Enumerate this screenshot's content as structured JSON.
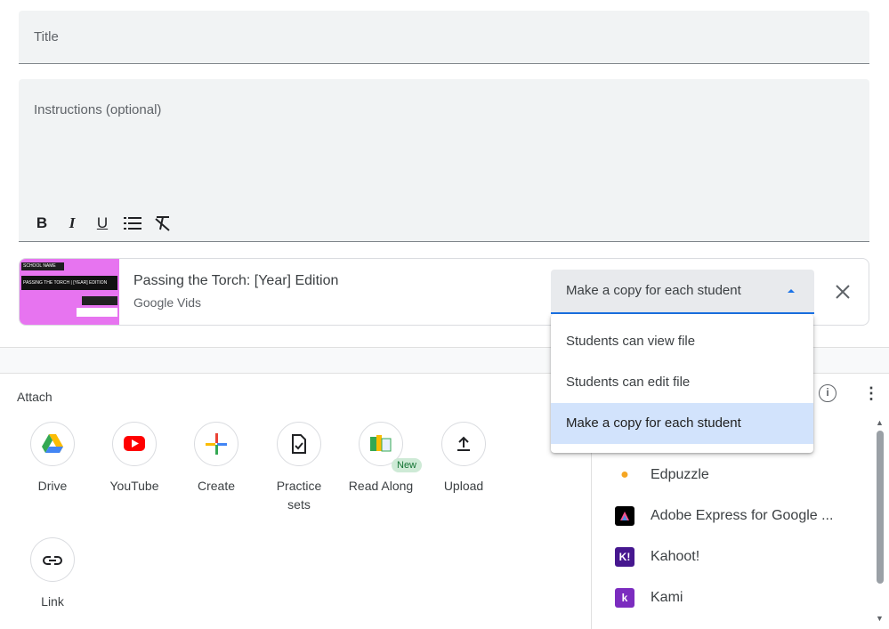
{
  "form": {
    "title_placeholder": "Title",
    "instructions_placeholder": "Instructions (optional)",
    "format_buttons": [
      "B",
      "I",
      "U"
    ]
  },
  "attachment": {
    "thumb_lines": [
      "SCHOOL NAME",
      "PASSING THE TORCH | [YEAR] EDITION"
    ],
    "title": "Passing the Torch: [Year] Edition",
    "subtitle": "Google Vids",
    "share_selected": "Make a copy for each student"
  },
  "dropdown": {
    "options": [
      "Students can view file",
      "Students can edit file",
      "Make a copy for each student"
    ],
    "selected_index": 2
  },
  "attach_section": {
    "label": "Attach",
    "items": [
      {
        "label": "Drive",
        "icon": "drive-icon"
      },
      {
        "label": "YouTube",
        "icon": "youtube-icon"
      },
      {
        "label": "Create",
        "icon": "plus-icon"
      },
      {
        "label": "Practice sets",
        "icon": "practice-sets-icon"
      },
      {
        "label": "Read Along",
        "icon": "read-along-icon",
        "badge": "New"
      },
      {
        "label": "Upload",
        "icon": "upload-icon"
      },
      {
        "label": "Link",
        "icon": "link-icon"
      }
    ]
  },
  "addons": {
    "items": [
      {
        "label": "Edpuzzle",
        "icon": "edpuzzle-icon",
        "color": "#f5a623"
      },
      {
        "label": "Adobe Express for Google ...",
        "icon": "adobe-express-icon",
        "color": "#000000"
      },
      {
        "label": "Kahoot!",
        "icon": "kahoot-icon",
        "color": "#46178f"
      },
      {
        "label": "Kami",
        "icon": "kami-icon",
        "color": "#7b2cbf"
      }
    ]
  },
  "colors": {
    "accent": "#1a73e8",
    "selected_bg": "#d2e3fc",
    "field_bg": "#f1f3f4",
    "thumb_bg": "#e774f0"
  }
}
